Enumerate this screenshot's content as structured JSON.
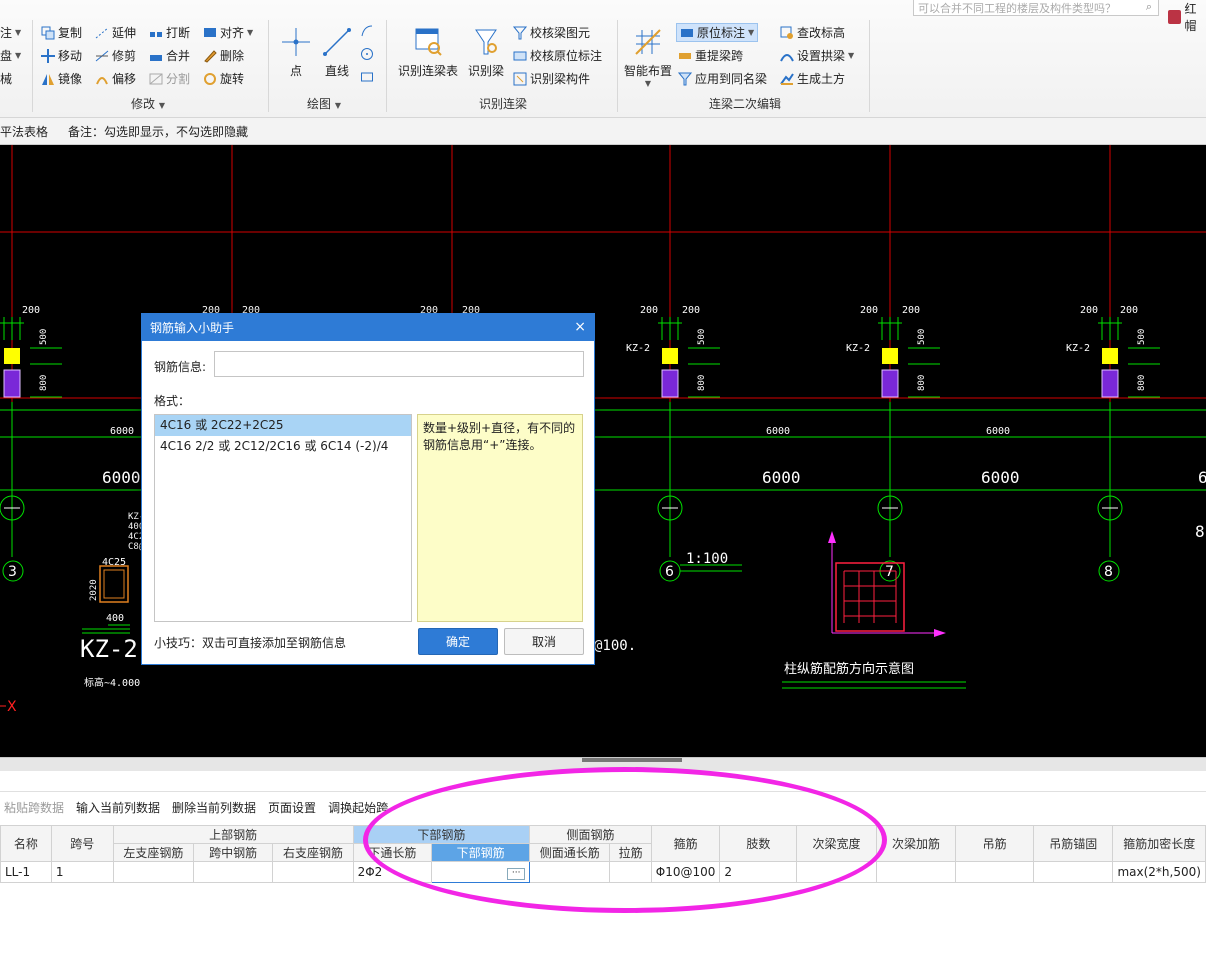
{
  "ribbon": {
    "search_placeholder": "可以合并不同工程的楼层及构件类型吗？",
    "user_label": "红帽",
    "left_cut_items": [
      "注",
      "盘",
      "械"
    ],
    "modify_items": [
      "复制",
      "延伸",
      "打断",
      "对齐",
      "移动",
      "修剪",
      "合并",
      "删除",
      "镜像",
      "偏移",
      "分割",
      "旋转"
    ],
    "modify_label": "修改",
    "draw_items": [
      "点",
      "直线"
    ],
    "draw_label": "绘图",
    "recognize_big": [
      "识别连梁表",
      "识别梁"
    ],
    "recognize_items": [
      "校核梁图元",
      "校核原位标注",
      "识别梁构件"
    ],
    "recognize_label": "识别连梁",
    "edit_big": "智能布置",
    "edit_items": [
      "原位标注",
      "查改标高",
      "重提梁跨",
      "设置拱梁",
      "应用到同名梁",
      "生成土方"
    ],
    "edit_label": "连梁二次编辑"
  },
  "infobar": {
    "left_text": "梁平法表格",
    "note_text": "备注：勾选即显示，不勾选即隐藏"
  },
  "cad": {
    "dim_200": "200",
    "dim_500": "500",
    "dim_800": "800",
    "span_small": "6000",
    "span_large": "6000",
    "axis_labels": [
      "3",
      "6",
      "7",
      "8"
    ],
    "col_label": "KZ-2",
    "col_label_big": "KZ-2",
    "elev_text": "标高~4.000",
    "scale_text": "1:100",
    "right_note": "柱纵筋配筋方向示意图",
    "x_axis": "X",
    "rebar_label": "4C25",
    "side_dim": "2020",
    "bottom_dim": "400",
    "partial_text": "@100.",
    "partial_8": "8",
    "partial_6": "6",
    "partial_kz": [
      "KZ-",
      "400",
      "4C2",
      "C8@"
    ]
  },
  "dialog": {
    "title": "钢筋输入小助手",
    "close_glyph": "×",
    "rebar_info_label": "钢筋信息:",
    "format_label": "格式：",
    "format_items": [
      "4C16 或 2C22+2C25",
      "4C16 2/2 或 2C12/2C16 或 6C14 (-2)/4"
    ],
    "note": "数量+级别+直径，有不同的钢筋信息用“+”连接。",
    "tip": "小技巧：双击可直接添加至钢筋信息",
    "ok": "确定",
    "cancel": "取消"
  },
  "bottom": {
    "toolbar": [
      "粘贴跨数据",
      "输入当前列数据",
      "删除当前列数据",
      "页面设置",
      "调换起始跨"
    ],
    "headers_top": {
      "name": "名称",
      "span": "跨号",
      "top_rebar": "上部钢筋",
      "bottom_rebar": "下部钢筋",
      "side_rebar": "侧面钢筋",
      "stirrup": "箍筋",
      "legs": "肢数",
      "sec_width": "次梁宽度",
      "sec_add": "次梁加筋",
      "hanger": "吊筋",
      "hanger_anchor": "吊筋锚固",
      "stirrup_dense": "箍筋加密长度"
    },
    "headers_sub": {
      "left_support": "左支座钢筋",
      "mid_span": "跨中钢筋",
      "right_support": "右支座钢筋",
      "bottom_through": "下通长筋",
      "bottom_rebar": "下部钢筋",
      "side_through": "侧面通长筋",
      "tie": "拉筋"
    },
    "row": {
      "name": "LL-1",
      "span": "1",
      "left_support": "",
      "mid_span": "",
      "right_support": "",
      "bottom_through": "2Φ2",
      "bottom_rebar": "",
      "side_through": "",
      "tie": "",
      "stirrup": "Φ10@100",
      "legs": "2",
      "sec_width": "",
      "sec_add": "",
      "hanger": "",
      "hanger_anchor": "",
      "stirrup_dense": "max(2*h,500)"
    },
    "cell_button": "···"
  },
  "colors": {
    "accent": "#2e7bd6",
    "highlight_ellipse": "#f226e6",
    "cad_bg": "#000000",
    "axis_red": "#d40000",
    "grid_green": "#00e000",
    "column_yellow": "#ffff00",
    "column_purple": "#8a2be2"
  }
}
